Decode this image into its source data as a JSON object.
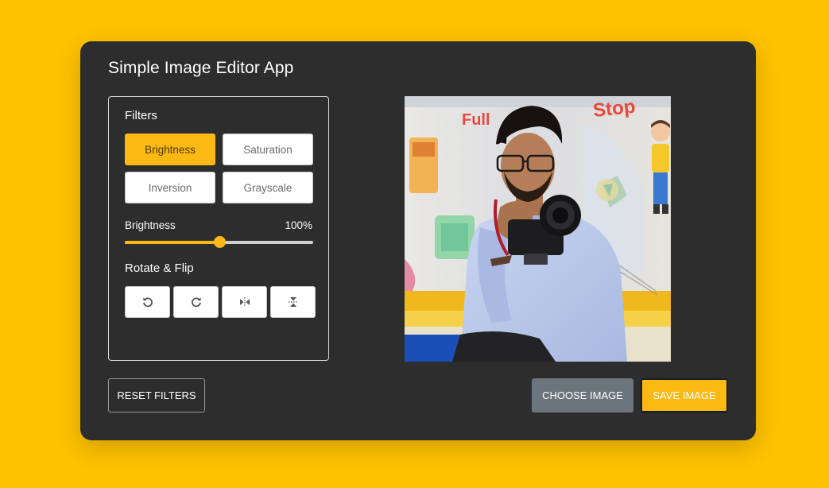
{
  "app": {
    "title": "Simple Image Editor App"
  },
  "filters": {
    "heading": "Filters",
    "buttons": [
      {
        "label": "Brightness",
        "active": true
      },
      {
        "label": "Saturation",
        "active": false
      },
      {
        "label": "Inversion",
        "active": false
      },
      {
        "label": "Grayscale",
        "active": false
      }
    ]
  },
  "slider": {
    "label": "Brightness",
    "value_text": "100%",
    "fraction": 0.5
  },
  "rotate": {
    "heading": "Rotate & Flip",
    "buttons": [
      {
        "icon": "rotate-left-icon"
      },
      {
        "icon": "rotate-right-icon"
      },
      {
        "icon": "flip-horizontal-icon"
      },
      {
        "icon": "flip-vertical-icon"
      }
    ]
  },
  "actions": {
    "reset_label": "Reset Filters",
    "choose_label": "Choose Image",
    "save_label": "Save Image"
  },
  "colors": {
    "background": "#fec200",
    "card": "#2d2d2d",
    "accent": "#fdb913",
    "choose_button": "#6c757d"
  },
  "preview": {
    "wall_text": [
      "Full",
      "Stop"
    ]
  }
}
